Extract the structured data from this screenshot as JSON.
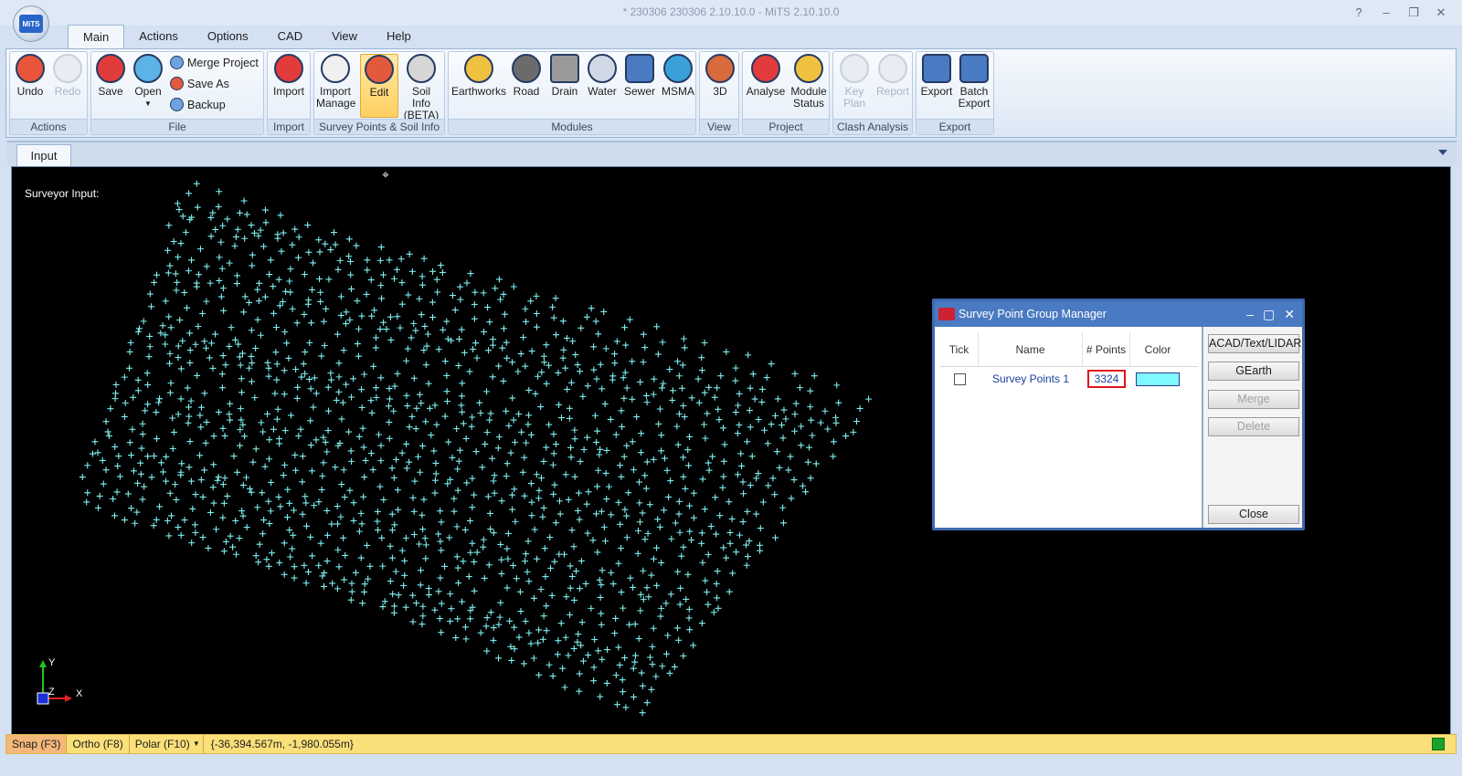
{
  "window": {
    "title": "* 230306 230306 2.10.10.0 - MiTS 2.10.10.0",
    "controls": [
      "?",
      "–",
      "❐",
      "✕"
    ],
    "logo_text": "MiTS"
  },
  "menu_tabs": [
    "Main",
    "Actions",
    "Options",
    "CAD",
    "View",
    "Help"
  ],
  "ribbon": {
    "groups": {
      "actions": "Actions",
      "file": "File",
      "import": "Import",
      "survey": "Survey Points & Soil Info",
      "modules": "Modules",
      "view": "View",
      "project": "Project",
      "clash": "Clash Analysis",
      "export": "Export"
    },
    "buttons": {
      "undo": "Undo",
      "redo": "Redo",
      "save": "Save",
      "open": "Open",
      "merge_project": "Merge Project",
      "save_as": "Save As",
      "backup": "Backup",
      "import": "Import",
      "import_manage_1": "Import",
      "import_manage_2": "Manage",
      "edit": "Edit",
      "soil_info_1": "Soil Info",
      "soil_info_2": "(BETA)",
      "earthworks": "Earthworks",
      "road": "Road",
      "drain": "Drain",
      "water": "Water",
      "sewer": "Sewer",
      "msma": "MSMA",
      "three_d": "3D",
      "analyse": "Analyse",
      "module_status_1": "Module",
      "module_status_2": "Status",
      "key_plan_1": "Key",
      "key_plan_2": "Plan",
      "report": "Report",
      "export": "Export",
      "batch_export_1": "Batch",
      "batch_export_2": "Export"
    }
  },
  "doc_tab": "Input",
  "canvas": {
    "label": "Surveyor Input:",
    "point_color": "#7ff0f0",
    "axis_y": "Y",
    "axis_z": "Z",
    "axis_x": "X"
  },
  "dialog": {
    "title": "Survey Point Group Manager",
    "columns": [
      "Tick",
      "Name",
      "# Points",
      "Color"
    ],
    "rows": [
      {
        "tick": false,
        "name": "Survey Points 1",
        "points": "3324",
        "color": "#7ff9ff"
      }
    ],
    "buttons": {
      "acad": "ACAD/Text/LIDAR",
      "gearth": "GEarth",
      "merge": "Merge",
      "delete": "Delete",
      "close": "Close"
    }
  },
  "statusbar": {
    "snap": "Snap (F3)",
    "ortho": "Ortho (F8)",
    "polar": "Polar (F10)",
    "coords": "{-36,394.567m, -1,980.055m}"
  }
}
